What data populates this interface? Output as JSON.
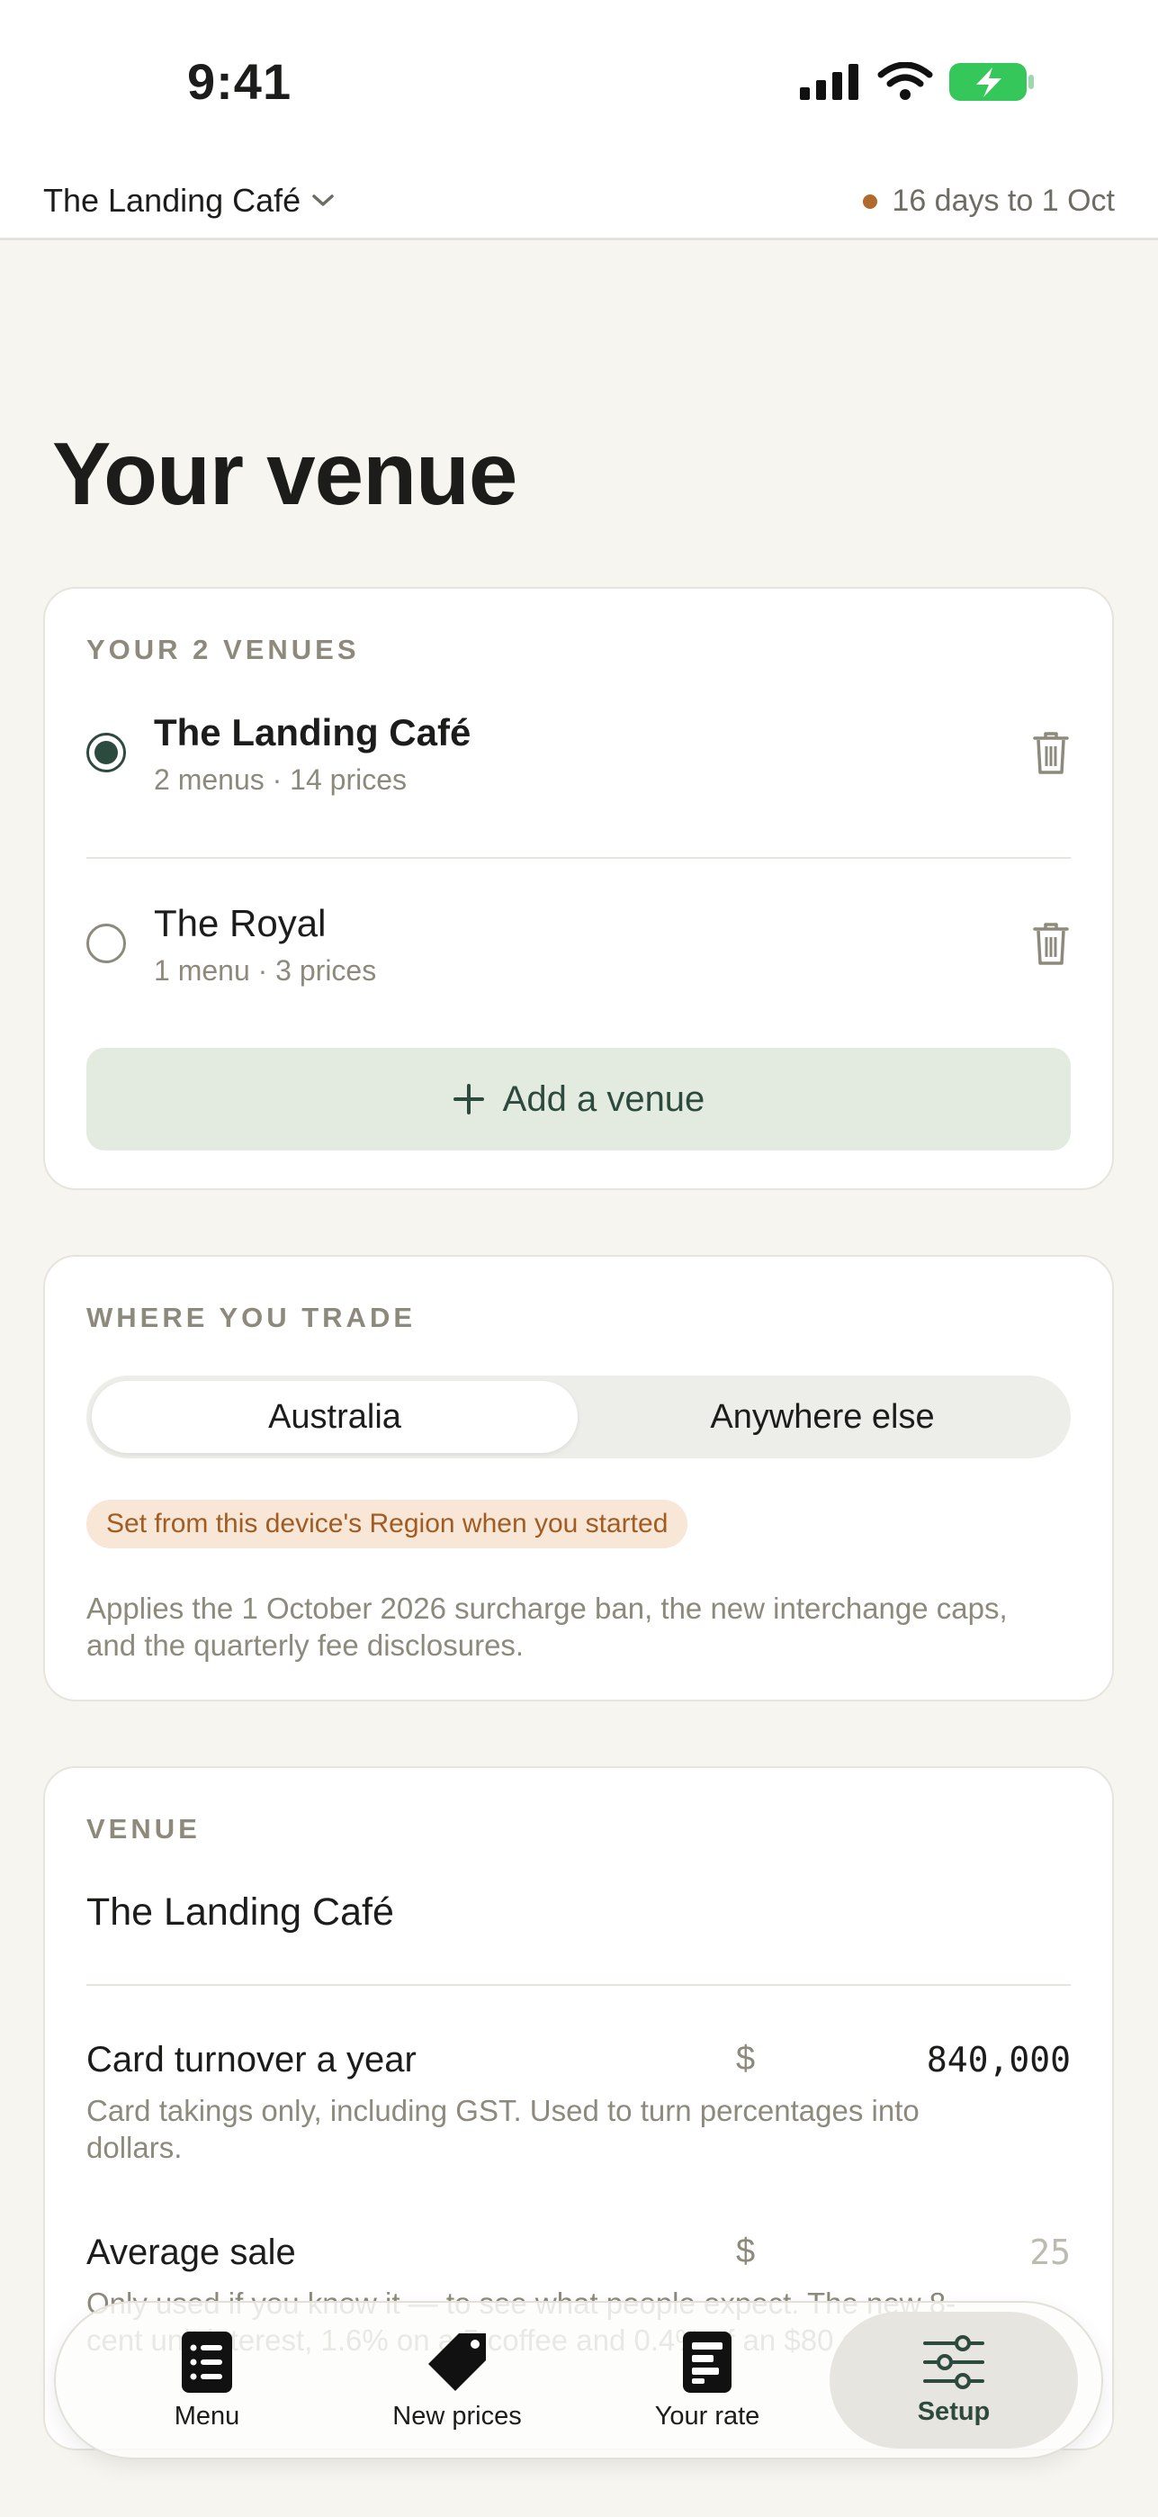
{
  "status": {
    "time": "9:41"
  },
  "topbar": {
    "venue": "The Landing Café",
    "deadline": "16 days to 1 Oct"
  },
  "page": {
    "title": "Your venue"
  },
  "venues": {
    "label": "YOUR 2 VENUES",
    "items": [
      {
        "name": "The Landing Café",
        "meta": "2 menus · 14 prices",
        "selected": true
      },
      {
        "name": "The Royal",
        "meta": "1 menu · 3 prices",
        "selected": false
      }
    ],
    "add_label": "Add a venue"
  },
  "trade": {
    "label": "WHERE YOU TRADE",
    "options": [
      "Australia",
      "Anywhere else"
    ],
    "selected": "Australia",
    "badge": "Set from this device's Region when you started",
    "note": "Applies the 1 October 2026 surcharge ban, the new interchange caps, and the quarterly fee disclosures."
  },
  "venue_form": {
    "label": "VENUE",
    "name": "The Landing Café",
    "turnover": {
      "label": "Card turnover a year",
      "currency": "$",
      "value": "840,000",
      "help": "Card takings only, including GST. Used to turn percentages into dollars."
    },
    "average_sale": {
      "label": "Average sale",
      "currency": "$",
      "placeholder": "25",
      "help": "Only used if you know it — to see what people expect. The new 8-cent unit interest, 1.6% on a 5 coffee and 0.4% of an $80 dinner."
    }
  },
  "tabs": [
    {
      "label": "Menu",
      "icon": "menu-list-icon"
    },
    {
      "label": "New prices",
      "icon": "price-tag-icon"
    },
    {
      "label": "Your rate",
      "icon": "rate-document-icon"
    },
    {
      "label": "Setup",
      "icon": "sliders-icon",
      "active": true
    }
  ],
  "colors": {
    "accent": "#2d4a3e",
    "deadline_dot": "#b06a2c",
    "background": "#f6f5f0"
  }
}
